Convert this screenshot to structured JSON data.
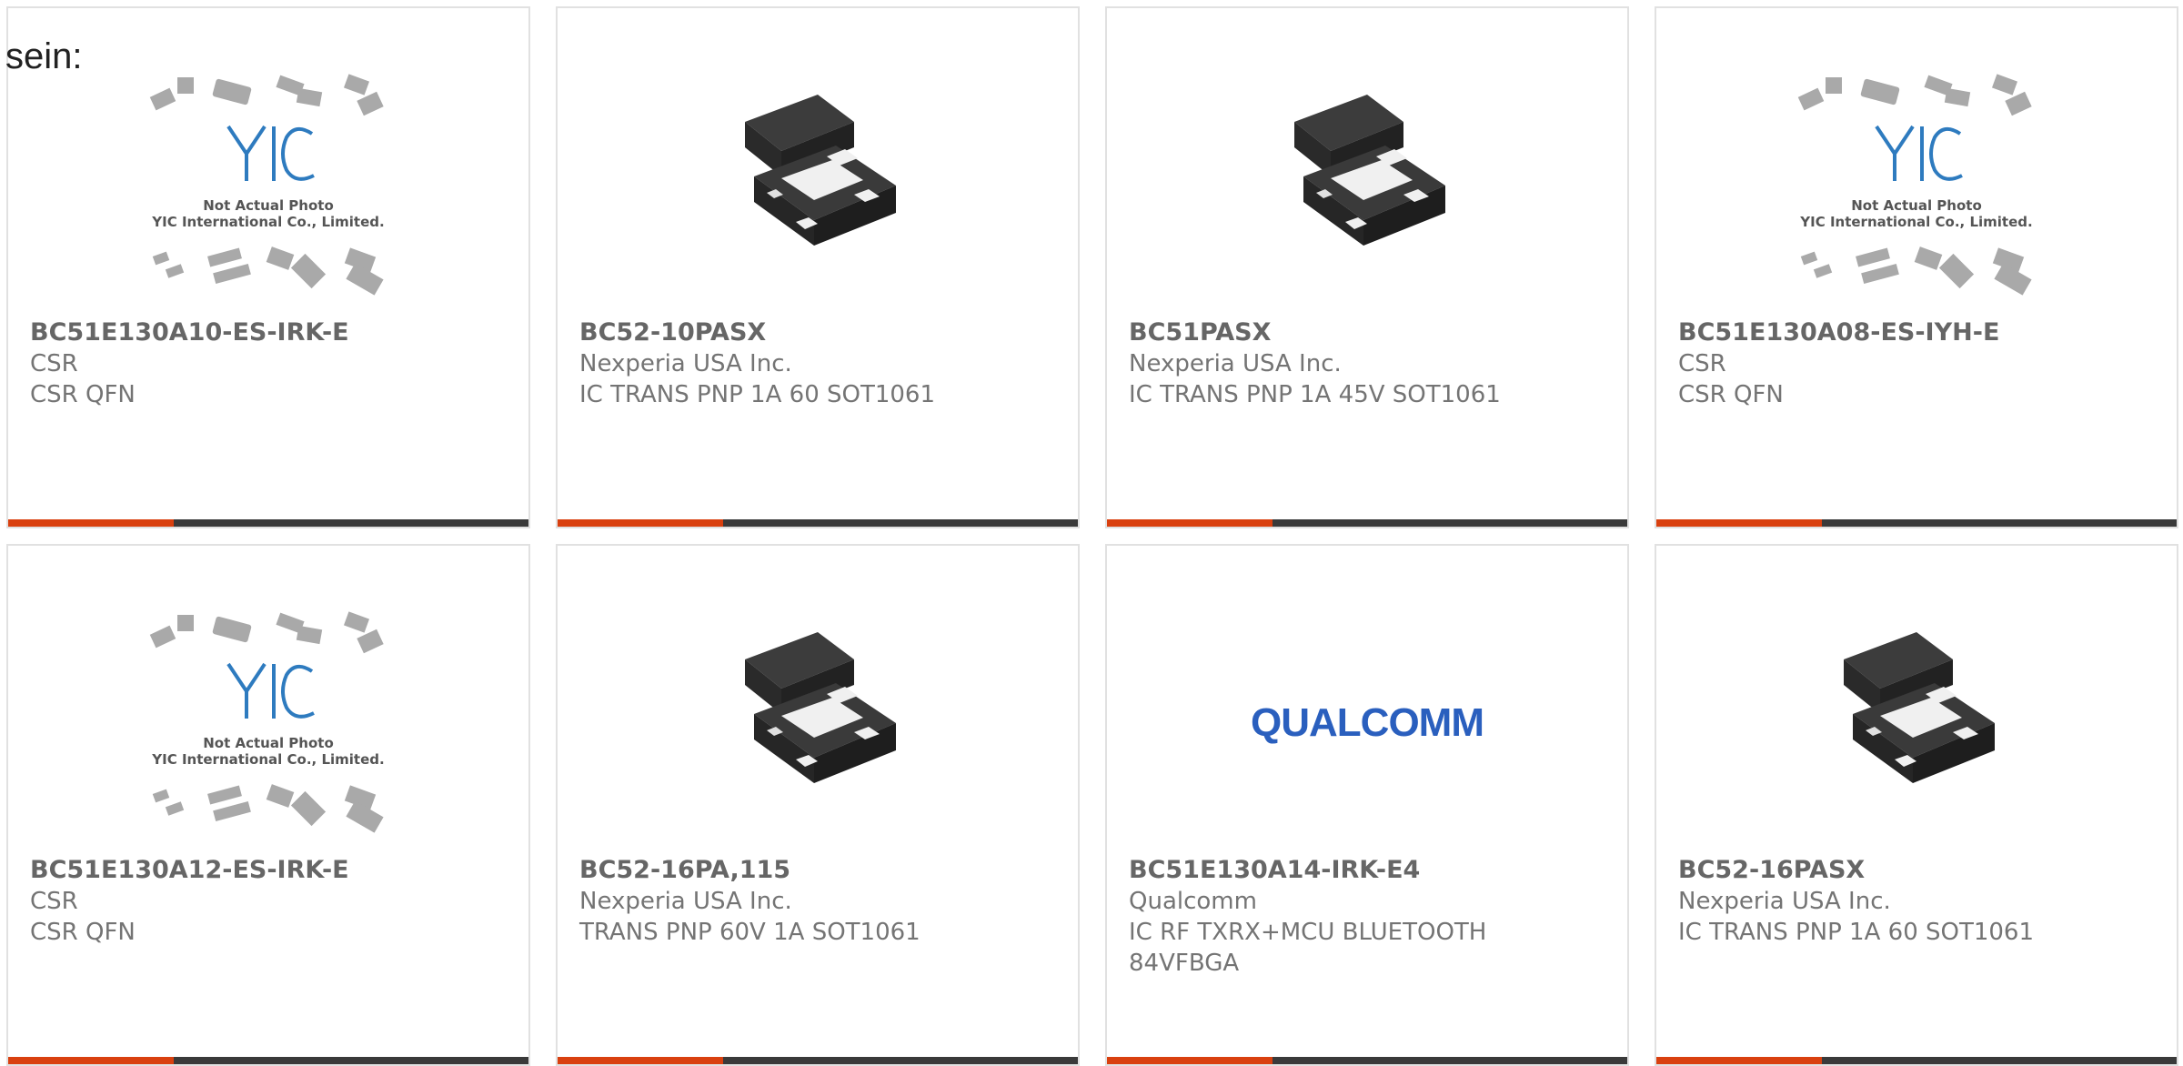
{
  "lead_text": "sein:",
  "placeholder": {
    "line1": "Not Actual Photo",
    "line2": "YIC International Co., Limited.",
    "logo": "YIC"
  },
  "qualcomm_logo": "QUALCOMM",
  "colors": {
    "accent": "#d9400f",
    "bar": "#3a3a3a",
    "border": "#e1e1e1",
    "text": "#747474"
  },
  "products": [
    {
      "part": "BC51E130A10-ES-IRK-E",
      "maker": "CSR",
      "desc": "CSR QFN",
      "image": "yic-placeholder-icon"
    },
    {
      "part": "BC52-10PASX",
      "maker": "Nexperia USA Inc.",
      "desc": "IC TRANS PNP 1A 60 SOT1061",
      "image": "chip-package-icon"
    },
    {
      "part": "BC51PASX",
      "maker": "Nexperia USA Inc.",
      "desc": "IC TRANS PNP 1A 45V SOT1061",
      "image": "chip-package-icon"
    },
    {
      "part": "BC51E130A08-ES-IYH-E",
      "maker": "CSR",
      "desc": "CSR QFN",
      "image": "yic-placeholder-icon"
    },
    {
      "part": "BC51E130A12-ES-IRK-E",
      "maker": "CSR",
      "desc": "CSR QFN",
      "image": "yic-placeholder-icon"
    },
    {
      "part": "BC52-16PA,115",
      "maker": "Nexperia USA Inc.",
      "desc": "TRANS PNP 60V 1A SOT1061",
      "image": "chip-package-icon"
    },
    {
      "part": "BC51E130A14-IRK-E4",
      "maker": "Qualcomm",
      "desc": "IC RF TXRX+MCU BLUETOOTH 84VFBGA",
      "image": "qualcomm-logo"
    },
    {
      "part": "BC52-16PASX",
      "maker": "Nexperia USA Inc.",
      "desc": "IC TRANS PNP 1A 60 SOT1061",
      "image": "chip-package-icon"
    }
  ]
}
